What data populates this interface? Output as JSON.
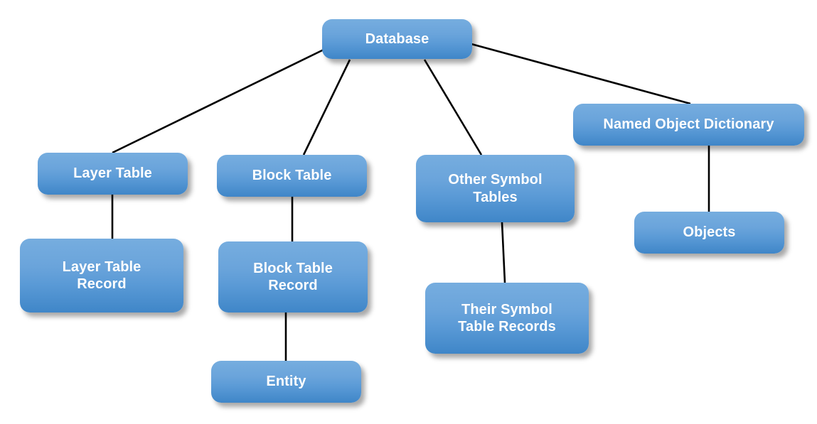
{
  "diagram": {
    "title": "Database Structure Hierarchy",
    "type": "tree-diagram",
    "background_color": "#ffffff",
    "node_fill_top": "#76ADDF",
    "node_fill_bottom": "#3F86C8",
    "node_text_color": "#ffffff",
    "connector_color": "#000000",
    "nodes": [
      {
        "id": "database",
        "label": "Database"
      },
      {
        "id": "layer_table",
        "label": "Layer Table"
      },
      {
        "id": "block_table",
        "label": "Block Table"
      },
      {
        "id": "other_symbol_tables",
        "label": "Other Symbol\nTables"
      },
      {
        "id": "named_object_dictionary",
        "label": "Named Object Dictionary"
      },
      {
        "id": "layer_table_record",
        "label": "Layer Table\nRecord"
      },
      {
        "id": "block_table_record",
        "label": "Block Table\nRecord"
      },
      {
        "id": "their_symbol_table_records",
        "label": "Their Symbol\nTable Records"
      },
      {
        "id": "objects",
        "label": "Objects"
      },
      {
        "id": "entity",
        "label": "Entity"
      }
    ],
    "edges": [
      {
        "from": "database",
        "to": "layer_table"
      },
      {
        "from": "database",
        "to": "block_table"
      },
      {
        "from": "database",
        "to": "other_symbol_tables"
      },
      {
        "from": "database",
        "to": "named_object_dictionary"
      },
      {
        "from": "layer_table",
        "to": "layer_table_record"
      },
      {
        "from": "block_table",
        "to": "block_table_record"
      },
      {
        "from": "block_table_record",
        "to": "entity"
      },
      {
        "from": "other_symbol_tables",
        "to": "their_symbol_table_records"
      },
      {
        "from": "named_object_dictionary",
        "to": "objects"
      }
    ]
  }
}
